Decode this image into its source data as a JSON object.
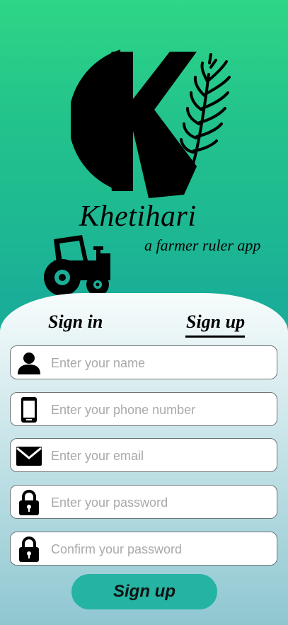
{
  "brand": {
    "title": "Khetihari",
    "tagline": "a farmer ruler app"
  },
  "tabs": {
    "sign_in": "Sign in",
    "sign_up": "Sign up",
    "active": "sign_up"
  },
  "form": {
    "fields": [
      {
        "icon": "person-icon",
        "placeholder": "Enter your name"
      },
      {
        "icon": "phone-icon",
        "placeholder": "Enter your phone number"
      },
      {
        "icon": "envelope-icon",
        "placeholder": "Enter your email"
      },
      {
        "icon": "lock-icon",
        "placeholder": "Enter your password"
      },
      {
        "icon": "lock-icon",
        "placeholder": "Confirm your password"
      }
    ],
    "submit_label": "Sign up"
  },
  "colors": {
    "accent": "#25b3a3",
    "header_gradient_top": "#2ed686",
    "header_gradient_bottom": "#1aad98"
  }
}
